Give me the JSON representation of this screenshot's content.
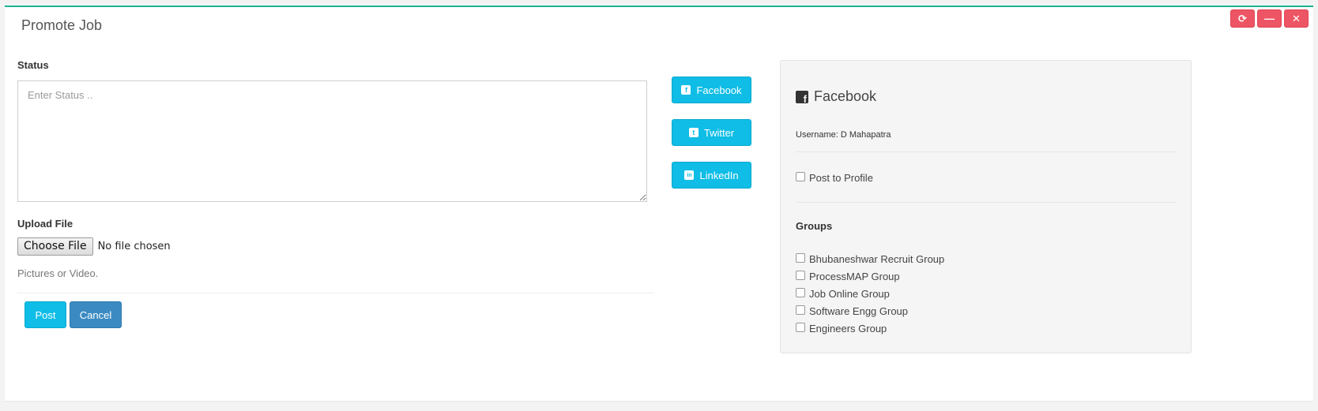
{
  "panel": {
    "title": "Promote Job",
    "tools": [
      {
        "icon": "refresh-icon",
        "symbol": "⟳"
      },
      {
        "icon": "minimize-icon",
        "symbol": "—"
      },
      {
        "icon": "close-icon",
        "symbol": "✕"
      }
    ]
  },
  "form": {
    "status_label": "Status",
    "status_placeholder": "Enter Status ..",
    "status_value": "",
    "upload_label": "Upload File",
    "choose_file_label": "Choose File",
    "no_file_text": "No file chosen",
    "help_text": "Pictures or Video.",
    "post_label": "Post",
    "cancel_label": "Cancel"
  },
  "social_buttons": [
    {
      "label": "Facebook",
      "icon": "facebook-icon",
      "glyph": "f"
    },
    {
      "label": "Twitter",
      "icon": "twitter-icon",
      "glyph": "t"
    },
    {
      "label": "LinkedIn",
      "icon": "linkedin-icon",
      "glyph": "in"
    }
  ],
  "facebook_panel": {
    "heading": "Facebook",
    "username": "Username: D Mahapatra",
    "post_to_profile": "Post to Profile",
    "groups_label": "Groups",
    "groups": [
      "Bhubaneshwar Recruit Group",
      "ProcessMAP Group",
      "Job Online Group",
      "Software Engg Group",
      "Engineers Group"
    ]
  },
  "colors": {
    "accent_top": "#1ab394",
    "social_button": "#0fbde6",
    "cancel_button": "#3b8bc2",
    "tool_button": "#ed5565"
  }
}
